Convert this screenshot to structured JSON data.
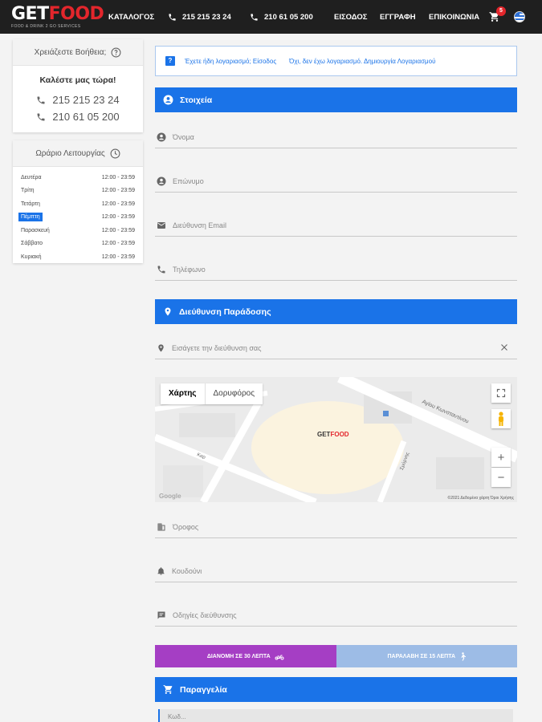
{
  "header": {
    "logo": {
      "word1": "GET",
      "word2": "FOOD",
      "tagline": "FOOD & DRINK 2 GO SERVICES"
    },
    "nav_catalog": "ΚΑΤΑΛΟΓΟΣ",
    "phone1": "215 215 23 24",
    "phone2": "210 61 05 200",
    "nav_login": "ΕΙΣΟΔΟΣ",
    "nav_register": "ΕΓΓΡΑΦΗ",
    "nav_contact": "ΕΠΙΚΟΙΝΩΝΙΑ",
    "cart_count": "5"
  },
  "help": {
    "heading": "Χρειάζεστε Βοήθεια;",
    "title": "Καλέστε μας τώρα!",
    "phones": [
      "215 215 23 24",
      "210 61 05 200"
    ]
  },
  "hours": {
    "heading": "Ωράριο Λειτουργίας",
    "rows": [
      {
        "day": "Δευτέρα",
        "time": "12:00 - 23:59"
      },
      {
        "day": "Τρίτη",
        "time": "12:00 - 23:59"
      },
      {
        "day": "Τετάρτη",
        "time": "12:00 - 23:59"
      },
      {
        "day": "Πέμπτη",
        "time": "12:00 - 23:59"
      },
      {
        "day": "Παρασκευή",
        "time": "12:00 - 23:59"
      },
      {
        "day": "Σάββατο",
        "time": "12:00 - 23:59"
      },
      {
        "day": "Κυριακή",
        "time": "12:00 - 23:59"
      }
    ],
    "today_index": 3
  },
  "account_notice": {
    "login_text": "Έχετε ήδη λογαριασμό; Είσοδος",
    "register_text": "Όχι, δεν έχω λογαριασμό. Δημιουργία Λογαριασμού"
  },
  "sections": {
    "details": "Στοιχεία",
    "address": "Διεύθυνση Παράδοσης",
    "order": "Παραγγελία"
  },
  "fields": {
    "first_name": "Όνομα",
    "last_name": "Επώνυμο",
    "email": "Διεύθυνση Email",
    "phone": "Τηλέφωνο",
    "address_search": "Εισάγετε την διεύθυνση σας",
    "floor": "Όροφος",
    "doorbell": "Κουδούνι",
    "directions": "Οδηγίες διεύθυνσης",
    "order_field": "Κωδ..."
  },
  "map": {
    "tab_map": "Χάρτης",
    "tab_satellite": "Δορυφόρος",
    "street1": "Αγίου Κωνσταντίνου",
    "street2": "Σμύρνης",
    "street3": "Καρ",
    "marker_logo_a": "GET",
    "marker_logo_b": "FOOD",
    "google": "Google",
    "footer": "©2021 Δεδομένα χάρτη   Όροι Χρήσης"
  },
  "delivery": {
    "delivery_label": "ΔΙΑΝΟΜΗ ΣΕ 30 ΛΕΠΤΑ",
    "pickup_label": "ΠΑΡΑΛΑΒΗ ΣΕ 15 ΛΕΠΤΑ"
  },
  "colors": {
    "primary": "#1a73e8",
    "brand_red": "#e3262c",
    "delivery_active": "#a53ec4",
    "pickup_inactive": "#9dbce6",
    "topbar": "#1f1f1f"
  }
}
